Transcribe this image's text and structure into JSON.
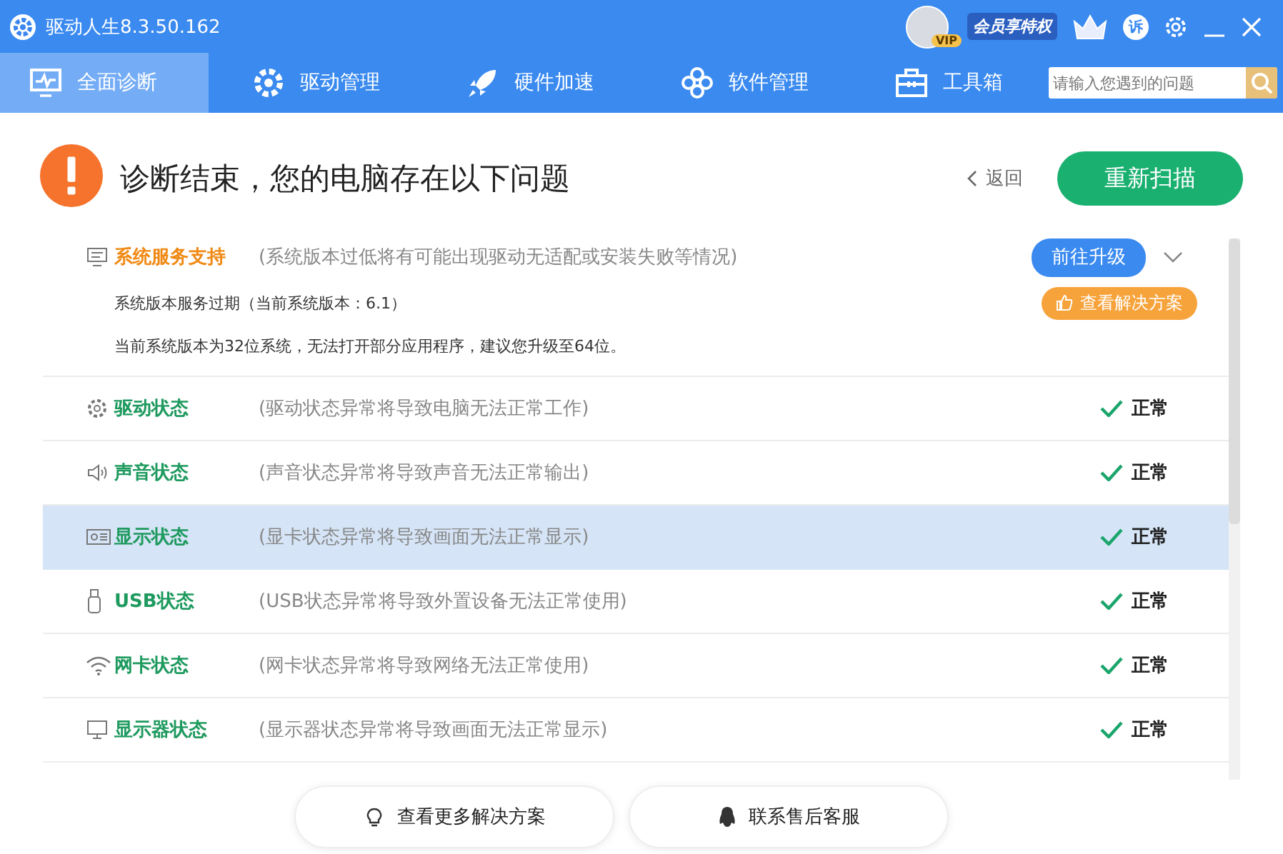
{
  "window": {
    "title": "驱动人生8.3.50.162",
    "vip_label": "会员享特权",
    "vip_badge": "VIP",
    "feedback_badge": "诉"
  },
  "tabs": [
    {
      "label": "全面诊断",
      "selected": true
    },
    {
      "label": "驱动管理",
      "selected": false
    },
    {
      "label": "硬件加速",
      "selected": false
    },
    {
      "label": "软件管理",
      "selected": false
    },
    {
      "label": "工具箱",
      "selected": false
    }
  ],
  "search": {
    "placeholder": "请输入您遇到的问题"
  },
  "header": {
    "title": "诊断结束，您的电脑存在以下问题",
    "back": "返回",
    "rescan": "重新扫描"
  },
  "items": [
    {
      "kind": "issue",
      "name": "系统服务支持",
      "desc": "(系统版本过低将有可能出现驱动无适配或安装失败等情况)",
      "action": "前往升级",
      "expanded": true,
      "selected": false,
      "details": [
        "系统版本服务过期（当前系统版本：6.1）",
        "当前系统版本为32位系统，无法打开部分应用程序，建议您升级至64位。"
      ],
      "solution": "查看解决方案"
    },
    {
      "kind": "ok",
      "name": "驱动状态",
      "desc": "(驱动状态异常将导致电脑无法正常工作)",
      "status": "正常",
      "selected": false
    },
    {
      "kind": "ok",
      "name": "声音状态",
      "desc": "(声音状态异常将导致声音无法正常输出)",
      "status": "正常",
      "selected": false
    },
    {
      "kind": "ok",
      "name": "显示状态",
      "desc": "(显卡状态异常将导致画面无法正常显示)",
      "status": "正常",
      "selected": true
    },
    {
      "kind": "ok",
      "name": "USB状态",
      "desc": "(USB状态异常将导致外置设备无法正常使用)",
      "status": "正常",
      "selected": false
    },
    {
      "kind": "ok",
      "name": "网卡状态",
      "desc": "(网卡状态异常将导致网络无法正常使用)",
      "status": "正常",
      "selected": false
    },
    {
      "kind": "ok",
      "name": "显示器状态",
      "desc": "(显示器状态异常将导致画面无法正常显示)",
      "status": "正常",
      "selected": false
    }
  ],
  "footer": [
    {
      "label": "查看更多解决方案"
    },
    {
      "label": "联系售后客服"
    }
  ]
}
